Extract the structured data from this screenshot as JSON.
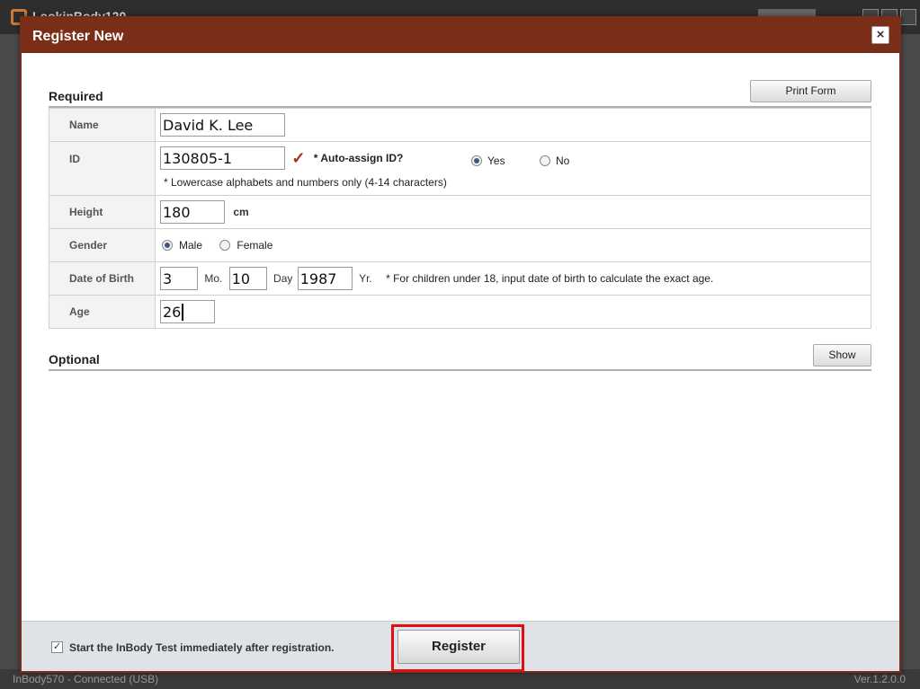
{
  "app": {
    "title": "LookinBody120",
    "status_left": "InBody570 - Connected (USB)",
    "status_right": "Ver.1.2.0.0"
  },
  "dialog": {
    "title": "Register New",
    "close_icon": "×"
  },
  "required": {
    "title": "Required",
    "print_button": "Print Form",
    "fields": {
      "name": {
        "label": "Name",
        "value": "David K. Lee"
      },
      "id": {
        "label": "ID",
        "value": "130805-1",
        "auto_assign_label": "* Auto-assign ID?",
        "yes_label": "Yes",
        "no_label": "No",
        "auto_assign_selected": "Yes",
        "note": "* Lowercase alphabets and numbers only (4-14 characters)"
      },
      "height": {
        "label": "Height",
        "value": "180",
        "unit": "cm"
      },
      "gender": {
        "label": "Gender",
        "male_label": "Male",
        "female_label": "Female",
        "selected": "Male"
      },
      "dob": {
        "label": "Date of Birth",
        "month": "3",
        "month_unit": "Mo.",
        "day": "10",
        "day_unit": "Day",
        "year": "1987",
        "year_unit": "Yr.",
        "note": "* For children under 18, input date of birth to calculate the exact age."
      },
      "age": {
        "label": "Age",
        "value": "26"
      }
    }
  },
  "optional": {
    "title": "Optional",
    "show_button": "Show"
  },
  "footer": {
    "start_test_checked": true,
    "start_test_label": "Start the InBody Test immediately after registration.",
    "register_button": "Register"
  },
  "colors": {
    "header": "#7a2e17",
    "highlight": "#e01010"
  }
}
